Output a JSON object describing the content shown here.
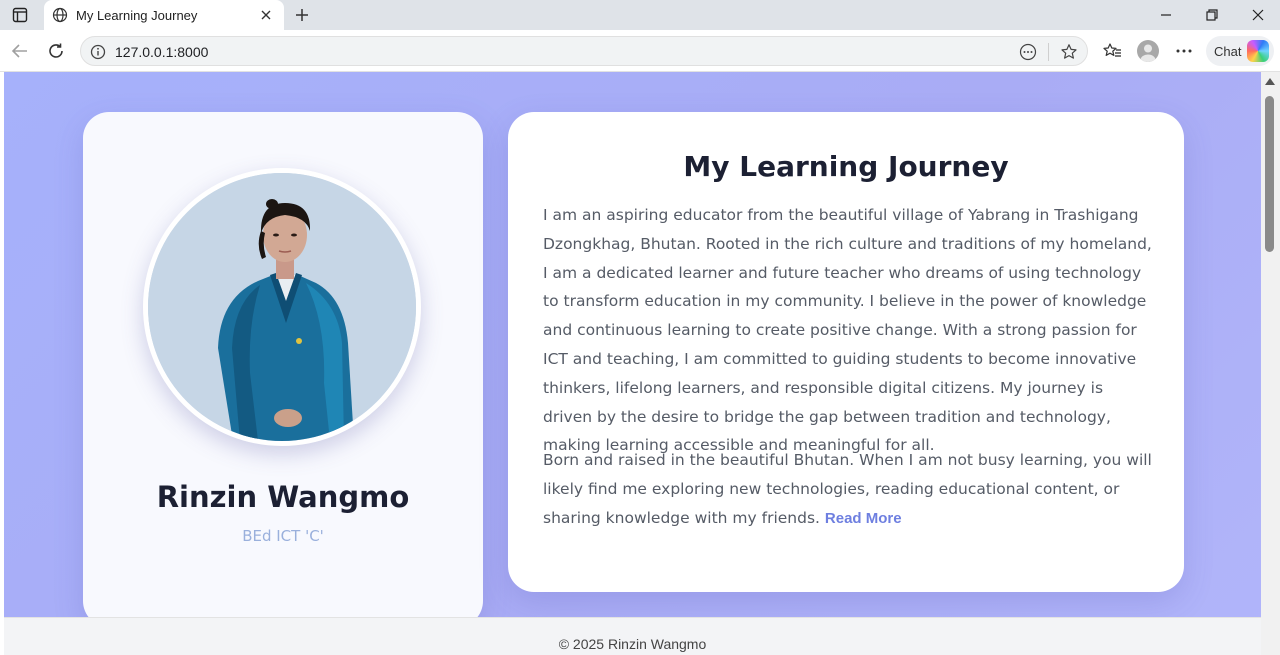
{
  "browser": {
    "tab_title": "My Learning Journey",
    "url": "127.0.0.1:8000",
    "chat_label": "Chat"
  },
  "profile": {
    "name": "Rinzin Wangmo",
    "subtitle": "BEd ICT 'C'"
  },
  "journey": {
    "title": "My Learning Journey",
    "paragraph1": "I am an aspiring educator from the beautiful village of Yabrang in Trashigang Dzongkhag, Bhutan. Rooted in the rich culture and traditions of my homeland, I am a dedicated learner and future teacher who dreams of using technology to transform education in my community. I believe in the power of knowledge and continuous learning to create positive change. With a strong passion for ICT and teaching, I am committed to guiding students to become innovative thinkers, lifelong learners, and responsible digital citizens. My journey is driven by the desire to bridge the gap between tradition and technology, making learning accessible and meaningful for all.",
    "paragraph2": "Born and raised in the beautiful Bhutan. When I am not busy learning, you will likely find me exploring new technologies, reading educational content, or sharing knowledge with my friends. ",
    "read_more": "Read More"
  },
  "footer": {
    "text": "© 2025 Rinzin Wangmo"
  },
  "colors": {
    "background": "#a9b0f8",
    "accent": "#6e7fe0",
    "subtitle": "#9ab0dc"
  }
}
